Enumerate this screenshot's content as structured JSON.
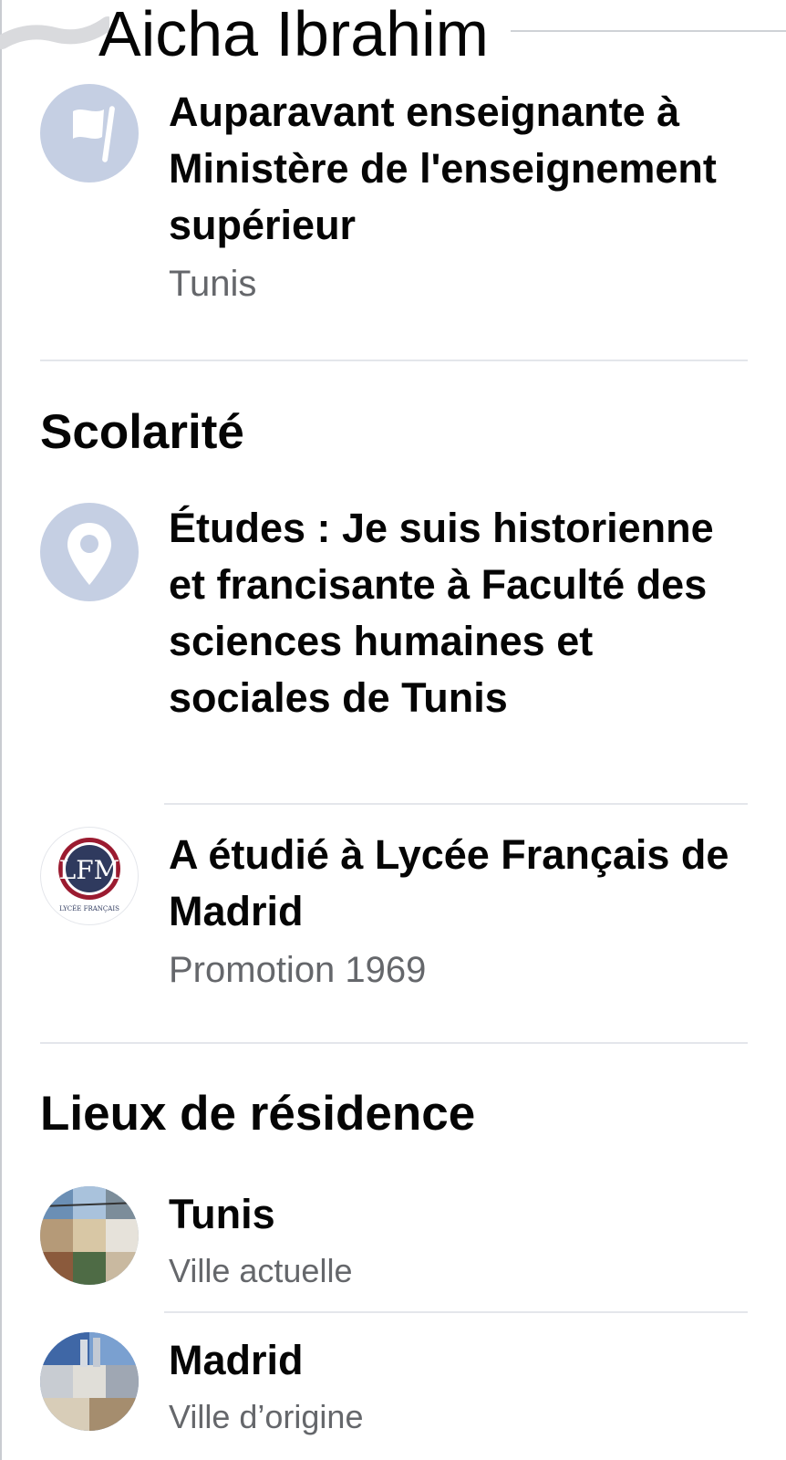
{
  "header": {
    "name": "Aicha Ibrahim"
  },
  "work": {
    "item": {
      "icon": "flag-icon",
      "main": "Auparavant enseignante à Ministère de l'enseignement supérieur",
      "sub": "Tunis"
    }
  },
  "education": {
    "title": "Scolarité",
    "items": [
      {
        "icon": "map-pin-icon",
        "main": "Études : Je suis historienne et francisante à Faculté des sciences humaines et sociales de Tunis"
      },
      {
        "icon": "school-logo",
        "main": "A étudié à Lycée Français de Madrid",
        "sub": "Promotion 1969"
      }
    ]
  },
  "places": {
    "title": "Lieux de résidence",
    "items": [
      {
        "icon": "city-photo-thumbnail",
        "main": "Tunis",
        "sub": "Ville actuelle"
      },
      {
        "icon": "city-photo-thumbnail",
        "main": "Madrid",
        "sub": "Ville d’origine"
      }
    ]
  },
  "colors": {
    "icon_bg": "#c5cfe3",
    "primary_text": "#050505",
    "secondary_text": "#65676b",
    "divider": "#e4e6eb",
    "school_logo_red": "#9b1b30"
  }
}
